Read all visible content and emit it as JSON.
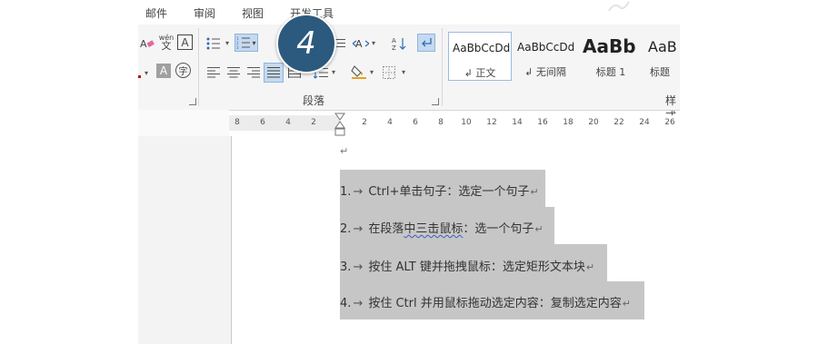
{
  "ribbon": {
    "tabs": [
      {
        "label": "邮件"
      },
      {
        "label": "审阅"
      },
      {
        "label": "视图"
      },
      {
        "label": "开发工具"
      }
    ],
    "paragraph_group_label": "段落",
    "styles_group_label": "样式",
    "styles": [
      {
        "sample": "AaBbCcDd",
        "name": "↲ 正文",
        "selected": true
      },
      {
        "sample": "AaBbCcDd",
        "name": "↲ 无间隔",
        "selected": false
      },
      {
        "sample": "AaBb",
        "name": "标题 1",
        "selected": false
      },
      {
        "sample": "AaB",
        "name": "标题",
        "selected": false
      }
    ],
    "icons": {
      "clear_format": "eraser-icon",
      "phonetic": "文",
      "phonetic_top": "wén",
      "char_border": "A",
      "char_shading": "A",
      "enclose": "字"
    }
  },
  "ruler": {
    "left_numbers": [
      "8",
      "6",
      "4",
      "2"
    ],
    "right_numbers": [
      "2",
      "4",
      "6",
      "8",
      "10",
      "12",
      "14",
      "16",
      "18",
      "20",
      "22",
      "24",
      "26"
    ]
  },
  "document": {
    "empty_para_mark": "↵",
    "lines": [
      {
        "num": "1.",
        "arrow": "→",
        "text": "Ctrl+单击句子：选定一个句子",
        "pm": "↵"
      },
      {
        "num": "2.",
        "arrow": "→",
        "pre": "在段落",
        "squiggle": "中三击鼠标",
        "text": "：选一个句子",
        "pm": "↵"
      },
      {
        "num": "3.",
        "arrow": "→",
        "text": "按住 ALT 键并拖拽鼠标：选定矩形文本块",
        "pm": "↵"
      },
      {
        "num": "4.",
        "arrow": "→",
        "text": "按住 Ctrl 并用鼠标拖动选定内容：复制选定内容",
        "pm": "↵"
      }
    ]
  },
  "step_badge": {
    "number": "4",
    "color": "#2b5a7e"
  },
  "colors": {
    "selection": "#c6c6c6",
    "badge": "#2b5a7e",
    "active_button": "#c5d9ef"
  }
}
